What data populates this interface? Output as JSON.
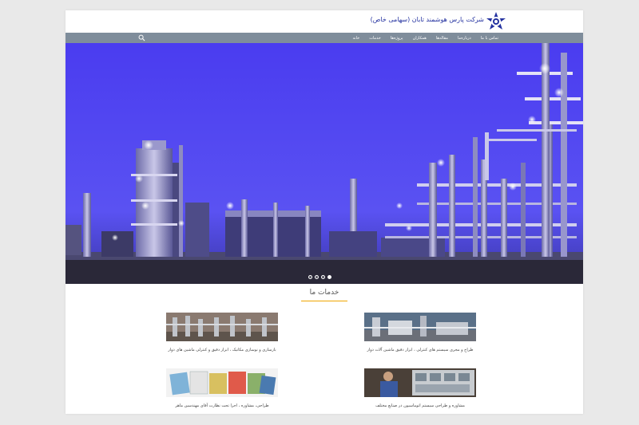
{
  "header": {
    "company_name": "شرکت پارس هوشمند تابان (سهامی خاص)",
    "brand_color": "#2432a0"
  },
  "nav": {
    "items": [
      "خانه",
      "خدمات",
      "پروژه‌ها",
      "همکاران",
      "مقاله‌ها",
      "درباره‌ما",
      "تماس با ما"
    ],
    "bar_color": "#7f8d9b",
    "search_icon": "search-icon"
  },
  "hero": {
    "slide_count": 4,
    "active_slide": 4
  },
  "services": {
    "title": "خدمات ما",
    "accent_color": "#f0a500",
    "items": [
      {
        "label": "طراح و مجری سیستم های کنترلی ، ابزار دقیق ماشین آلات دوار"
      },
      {
        "label": "بازسازی و نوسازی مکانیک ، ابزار دقیق و کنترلی ماشین های دوار"
      },
      {
        "label": "مشاوره و طراحی سیستم اتوماسیون در صنایع مختلف"
      },
      {
        "label": "طراحی، مشاوره ، اجرا تحت نظارت آقای مهندسین ماهر"
      }
    ]
  }
}
